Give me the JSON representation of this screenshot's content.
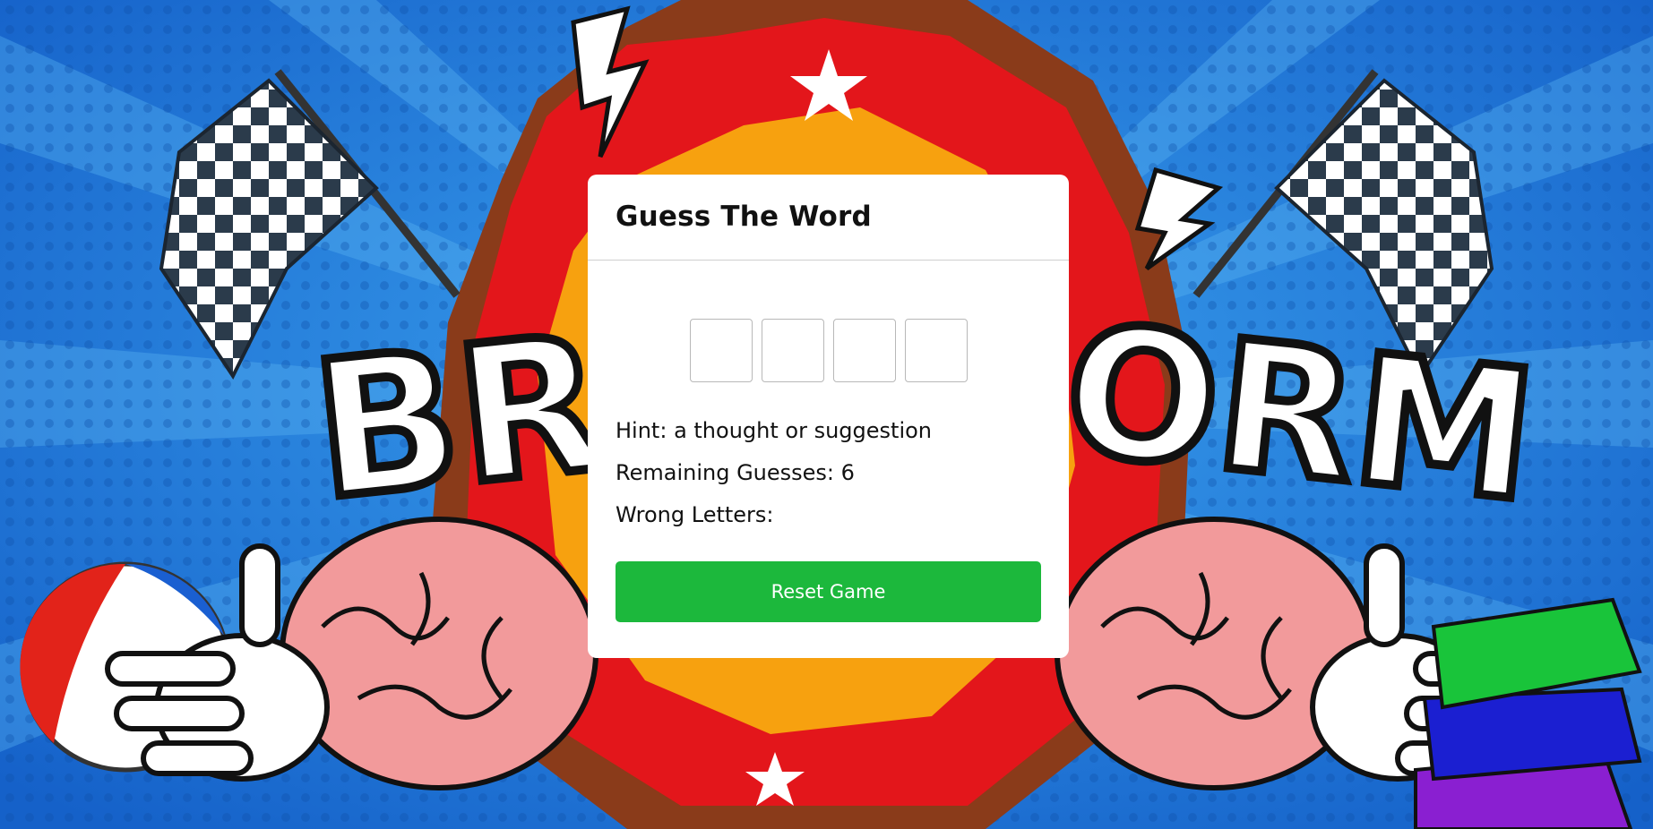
{
  "game": {
    "title": "Guess The Word",
    "word_length": 4,
    "hint_label": "Hint:",
    "hint": "a thought or suggestion",
    "remaining_label": "Remaining Guesses:",
    "remaining": "6",
    "wrong_label": "Wrong Letters:",
    "wrong_letters": "",
    "reset_label": "Reset Game",
    "button_color": "#1cb83c"
  },
  "background": {
    "banner_text_left": "BRA",
    "banner_text_right": "ORM",
    "sky_color": "#1f78d8"
  }
}
